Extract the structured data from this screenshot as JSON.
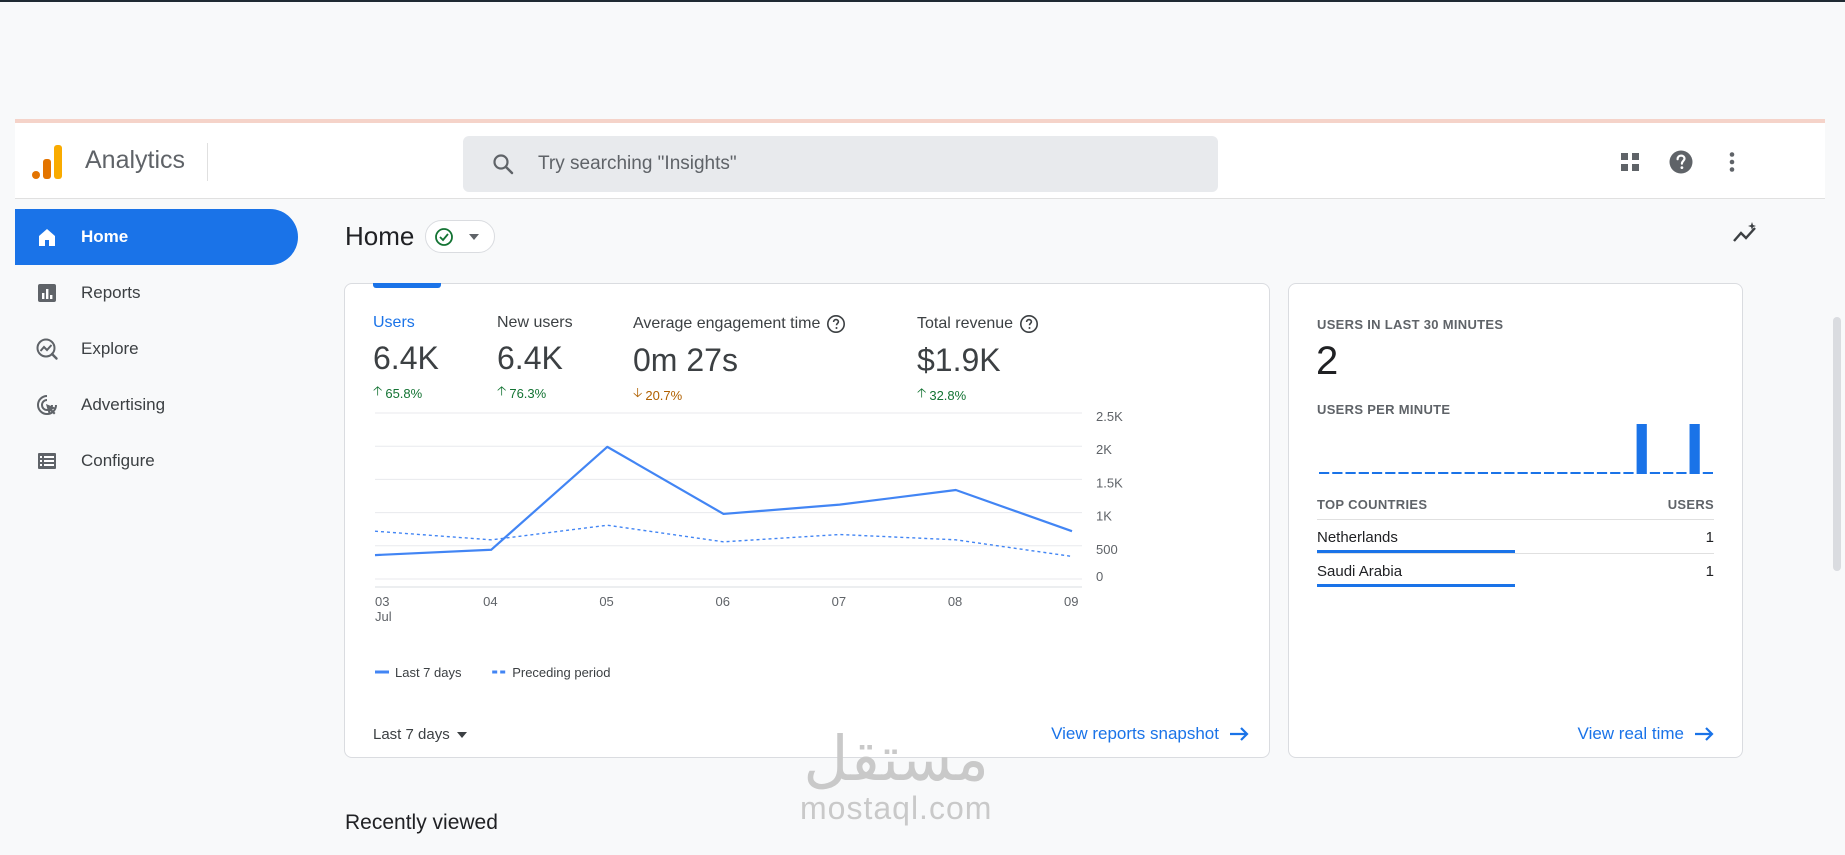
{
  "app": {
    "title": "Analytics"
  },
  "search": {
    "placeholder": "Try searching \"Insights\""
  },
  "sidebar": {
    "items": [
      {
        "label": "Home",
        "icon": "home-icon"
      },
      {
        "label": "Reports",
        "icon": "reports-icon"
      },
      {
        "label": "Explore",
        "icon": "explore-icon"
      },
      {
        "label": "Advertising",
        "icon": "advertising-icon"
      },
      {
        "label": "Configure",
        "icon": "configure-icon"
      }
    ]
  },
  "page": {
    "title": "Home"
  },
  "metrics": [
    {
      "label": "Users",
      "value": "6.4K",
      "change": "65.8%",
      "direction": "up"
    },
    {
      "label": "New users",
      "value": "6.4K",
      "change": "76.3%",
      "direction": "up"
    },
    {
      "label": "Average engagement time",
      "value": "0m 27s",
      "change": "20.7%",
      "direction": "down"
    },
    {
      "label": "Total revenue",
      "value": "$1.9K",
      "change": "32.8%",
      "direction": "up"
    }
  ],
  "chart_data": {
    "type": "line",
    "x": [
      "03",
      "04",
      "05",
      "06",
      "07",
      "08",
      "09"
    ],
    "x_sublabel": "Jul",
    "yticks": [
      "2.5K",
      "2K",
      "1.5K",
      "1K",
      "500",
      "0"
    ],
    "ylim": [
      0,
      2500
    ],
    "series": [
      {
        "name": "Last 7 days",
        "values": [
          360,
          440,
          1990,
          980,
          1120,
          1340,
          720
        ],
        "color": "#4285f4",
        "style": "solid"
      },
      {
        "name": "Preceding period",
        "values": [
          720,
          590,
          810,
          560,
          670,
          590,
          340
        ],
        "color": "#4285f4",
        "style": "dashed"
      }
    ]
  },
  "card": {
    "date_range": "Last 7 days",
    "view_link": "View reports snapshot"
  },
  "realtime": {
    "heading": "USERS IN LAST 30 MINUTES",
    "count": "2",
    "per_minute_label": "USERS PER MINUTE",
    "per_minute": [
      0,
      0,
      0,
      0,
      0,
      0,
      0,
      0,
      0,
      0,
      0,
      0,
      0,
      0,
      0,
      0,
      0,
      0,
      0,
      0,
      0,
      0,
      0,
      0,
      1,
      0,
      0,
      0,
      1,
      0
    ],
    "countries_header": "TOP COUNTRIES",
    "users_header": "USERS",
    "countries": [
      {
        "name": "Netherlands",
        "users": "1"
      },
      {
        "name": "Saudi Arabia",
        "users": "1"
      }
    ],
    "view_link": "View real time"
  },
  "recently_viewed": "Recently viewed",
  "watermark": {
    "arabic": "مستقل",
    "latin": "mostaql.com"
  }
}
